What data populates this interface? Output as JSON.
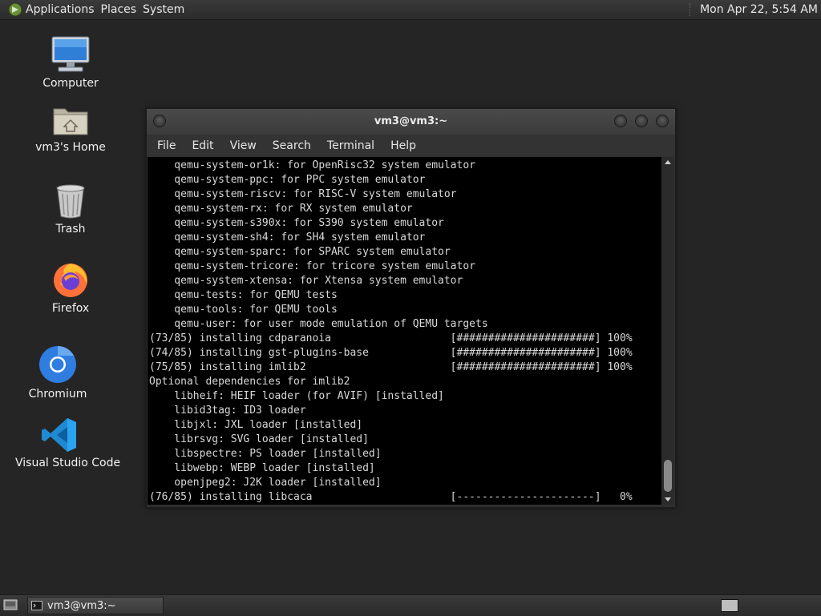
{
  "top_panel": {
    "menus": [
      "Applications",
      "Places",
      "System"
    ],
    "clock": "Mon Apr 22,  5:54 AM"
  },
  "desktop_icons": [
    {
      "label": "Computer",
      "icon": "computer-icon"
    },
    {
      "label": "vm3's Home",
      "icon": "home-folder-icon"
    },
    {
      "label": "Trash",
      "icon": "trash-icon"
    },
    {
      "label": "Firefox",
      "icon": "firefox-icon"
    },
    {
      "label": "Chromium",
      "icon": "chromium-icon"
    },
    {
      "label": "Visual Studio Code",
      "icon": "vscode-icon"
    }
  ],
  "terminal": {
    "title": "vm3@vm3:~",
    "menu": [
      "File",
      "Edit",
      "View",
      "Search",
      "Terminal",
      "Help"
    ],
    "lines": [
      "    qemu-system-or1k: for OpenRisc32 system emulator",
      "    qemu-system-ppc: for PPC system emulator",
      "    qemu-system-riscv: for RISC-V system emulator",
      "    qemu-system-rx: for RX system emulator",
      "    qemu-system-s390x: for S390 system emulator",
      "    qemu-system-sh4: for SH4 system emulator",
      "    qemu-system-sparc: for SPARC system emulator",
      "    qemu-system-tricore: for tricore system emulator",
      "    qemu-system-xtensa: for Xtensa system emulator",
      "    qemu-tests: for QEMU tests",
      "    qemu-tools: for QEMU tools",
      "    qemu-user: for user mode emulation of QEMU targets",
      "(73/85) installing cdparanoia                   [######################] 100%",
      "(74/85) installing gst-plugins-base             [######################] 100%",
      "(75/85) installing imlib2                       [######################] 100%",
      "Optional dependencies for imlib2",
      "    libheif: HEIF loader (for AVIF) [installed]",
      "    libid3tag: ID3 loader",
      "    libjxl: JXL loader [installed]",
      "    librsvg: SVG loader [installed]",
      "    libspectre: PS loader [installed]",
      "    libwebp: WEBP loader [installed]",
      "    openjpeg2: J2K loader [installed]",
      "(76/85) installing libcaca                      [----------------------]   0%"
    ]
  },
  "taskbar": {
    "task_label": "vm3@vm3:~"
  },
  "colors": {
    "desktop_bg": "#252525",
    "terminal_bg": "#000000",
    "terminal_fg": "#d8d8d8"
  }
}
